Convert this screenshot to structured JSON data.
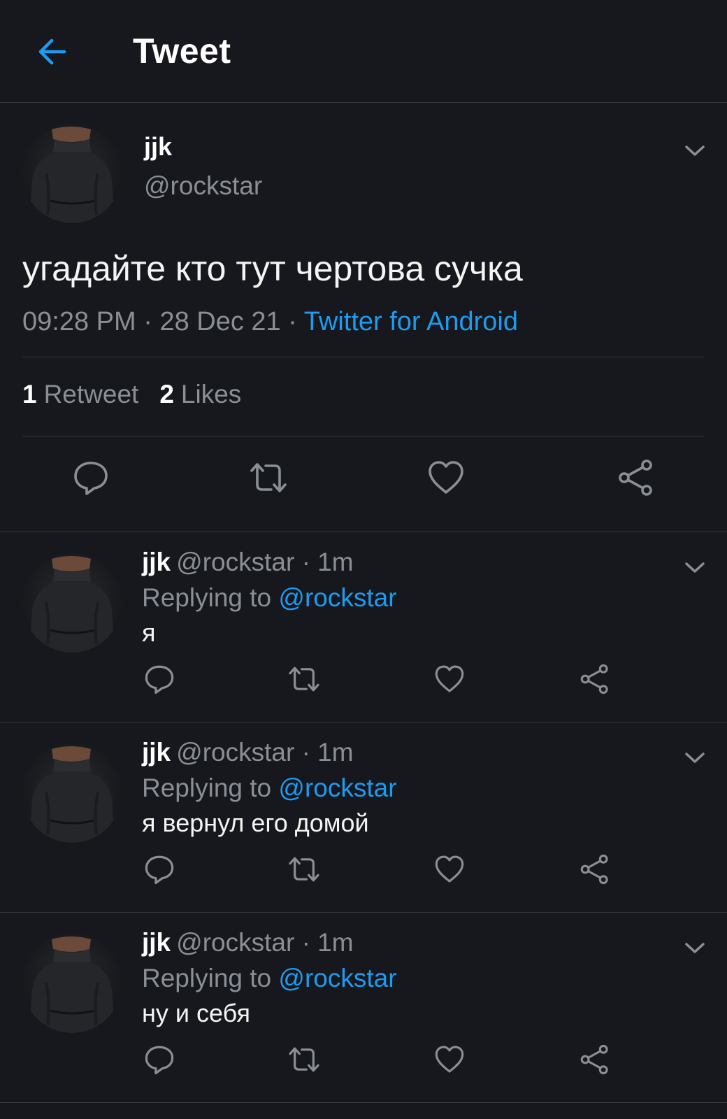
{
  "header": {
    "title": "Tweet"
  },
  "icons": {
    "back": "arrow-left-icon",
    "chevron": "chevron-down-icon",
    "reply": "speech-bubble-icon",
    "retweet": "retweet-icon",
    "like": "heart-icon",
    "share": "share-icon"
  },
  "colors": {
    "background": "#17181d",
    "accent": "#1d9bf0",
    "muted_text": "#8a8f96",
    "divider": "#34373d"
  },
  "tweet": {
    "name": "jjk",
    "handle": "@rockstar",
    "text": "угадайте кто тут чертова сучка",
    "time": "09:28 PM",
    "date": "28 Dec 21",
    "separator": "·",
    "source": "Twitter for Android",
    "stats": {
      "retweets_count": "1",
      "retweets_label": "Retweet",
      "likes_count": "2",
      "likes_label": "Likes"
    }
  },
  "replies": [
    {
      "name": "jjk",
      "handle": "@rockstar",
      "time": "· 1m",
      "replying_label": "Replying to",
      "replying_to": "@rockstar",
      "text": "я"
    },
    {
      "name": "jjk",
      "handle": "@rockstar",
      "time": "· 1m",
      "replying_label": "Replying to",
      "replying_to": "@rockstar",
      "text": "я вернул его домой"
    },
    {
      "name": "jjk",
      "handle": "@rockstar",
      "time": "· 1m",
      "replying_label": "Replying to",
      "replying_to": "@rockstar",
      "text": "ну и себя"
    }
  ]
}
